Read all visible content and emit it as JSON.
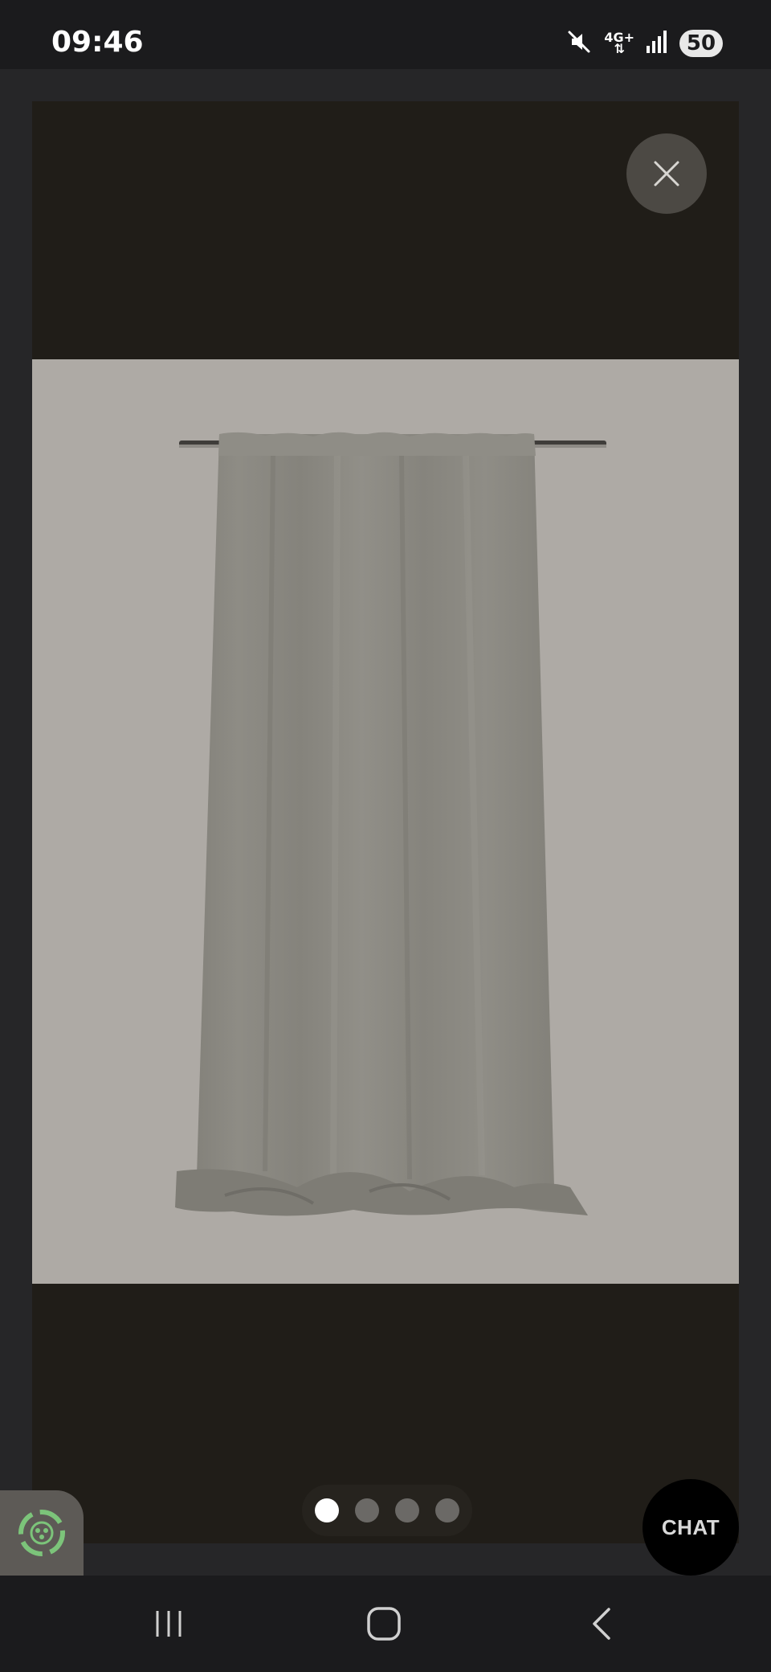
{
  "status_bar": {
    "time": "09:46",
    "network_label": "4G+",
    "battery": "50"
  },
  "viewer": {
    "image_alt": "Grey linen curtain hanging on rod",
    "close_icon": "close-icon",
    "pagination": {
      "count": 4,
      "active_index": 0
    },
    "chat_label": "CHAT",
    "eco_icon": "eco-recycle-icon"
  },
  "nav_bar": {
    "recents_icon": "recents-icon",
    "home_icon": "home-icon",
    "back_icon": "back-icon"
  },
  "colors": {
    "stage_background": "#201d18",
    "photo_background": "#aeaaa5",
    "curtain": "#8a8880",
    "active_dot": "#ffffff",
    "inactive_dot": "#6b6966",
    "eco_green": "#7cc47a"
  }
}
